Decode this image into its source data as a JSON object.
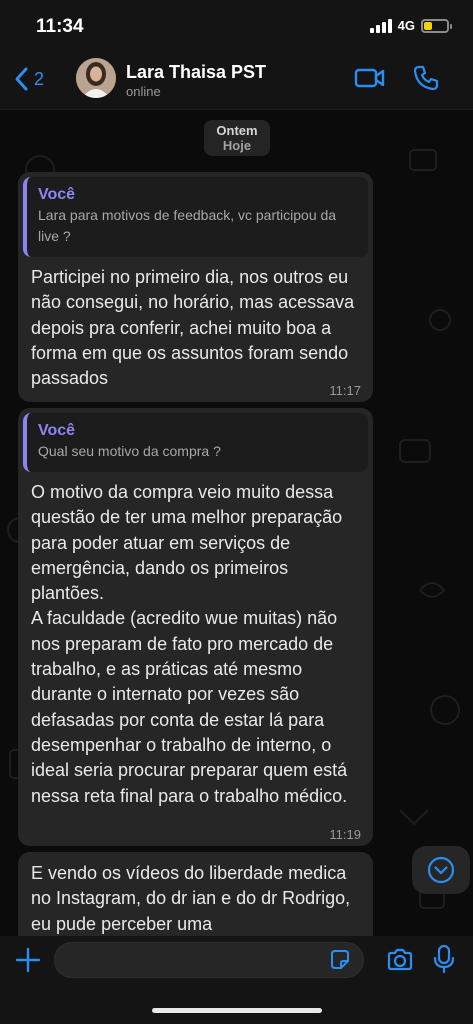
{
  "status_bar": {
    "time": "11:34",
    "network": "4G",
    "battery_level": 0.35,
    "battery_color": "#f5d20a"
  },
  "header": {
    "back_icon": "chevron-left-icon",
    "back_count": "2",
    "contact_name": "Lara Thaisa PST",
    "contact_status": "online",
    "video_icon": "video-camera-icon",
    "call_icon": "phone-icon",
    "accent_color": "#2b8ef0"
  },
  "chat": {
    "date_chip_top": "Ontem",
    "date_chip_bottom": "Hoje",
    "messages": [
      {
        "quote_author": "Você",
        "quote_text": "Lara para motivos de feedback, vc participou da live ?",
        "text": "Participei no primeiro dia, nos outros eu não consegui, no horário, mas acessava depois pra conferir, achei muito boa a forma em que os assuntos foram sendo passados",
        "time": "11:17"
      },
      {
        "quote_author": "Você",
        "quote_text": "Qual seu motivo da compra ?",
        "text": "O motivo da compra veio muito dessa questão de ter uma melhor preparação para poder atuar em serviços de emergência, dando os primeiros plantões.\nA faculdade (acredito wue muitas) não nos preparam de fato pro mercado de trabalho, e as práticas até mesmo durante o internato por vezes são defasadas por conta de estar lá para desempenhar o trabalho de interno, o ideal seria procurar preparar quem está nessa reta final para o trabalho médico.",
        "time": "11:19"
      },
      {
        "text": "E vendo os vídeos do liberdade medica no Instagram, do dr ian e do dr Rodrigo, eu pude perceber uma"
      }
    ],
    "quote_color": "#8a84f2",
    "scroll_down_icon": "chevron-down-circle-icon"
  },
  "input_bar": {
    "plus_icon": "plus-icon",
    "input_value": "",
    "sticker_icon": "sticker-icon",
    "camera_icon": "camera-icon",
    "mic_icon": "microphone-icon"
  }
}
